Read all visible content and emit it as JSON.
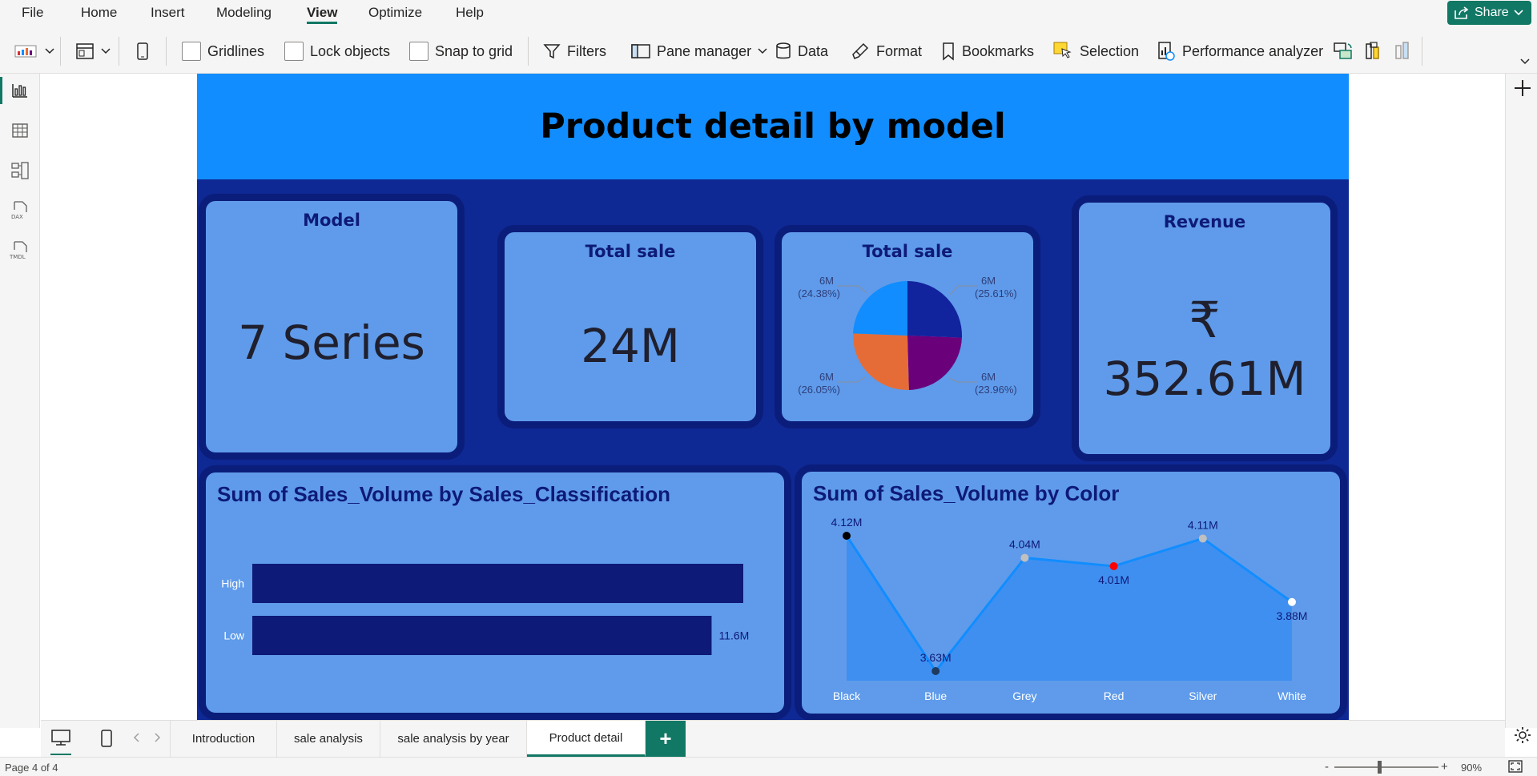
{
  "menu": {
    "items": [
      "File",
      "Home",
      "Insert",
      "Modeling",
      "View",
      "Optimize",
      "Help"
    ],
    "active": "View",
    "share_label": "Share"
  },
  "ribbon": {
    "gridlines": "Gridlines",
    "lock_objects": "Lock objects",
    "snap_to_grid": "Snap to grid",
    "filters": "Filters",
    "pane_manager": "Pane manager",
    "data": "Data",
    "format": "Format",
    "bookmarks": "Bookmarks",
    "selection": "Selection",
    "performance_analyzer": "Performance analyzer"
  },
  "rail": {
    "items": [
      "report-view-icon",
      "table-view-icon",
      "model-view-icon",
      "dax-query-icon",
      "tmdl-view-icon"
    ],
    "dax_label": "DAX",
    "tmdl_label": "TMDL"
  },
  "report": {
    "title": "Product detail by model",
    "model_card": {
      "title": "Model",
      "value": "7 Series"
    },
    "total_sale_card": {
      "title": "Total sale",
      "value": "24M"
    },
    "pie_card": {
      "title": "Total sale"
    },
    "revenue_card": {
      "title": "Revenue",
      "currency": "₹",
      "value": "352.61M"
    },
    "colors": {
      "title_band": "#118dff",
      "background": "#0e2894",
      "card": "#5f9bea",
      "bar": "#0e1a77",
      "line": "#118dff",
      "area": "#3f8ff1"
    }
  },
  "chart_data": [
    {
      "type": "pie",
      "title": "Total sale",
      "slices": [
        {
          "value_label": "6M",
          "percent_label": "(25.61%)",
          "percent": 25.61,
          "color": "#12239e"
        },
        {
          "value_label": "6M",
          "percent_label": "(23.96%)",
          "percent": 23.96,
          "color": "#6b007b"
        },
        {
          "value_label": "6M",
          "percent_label": "(26.05%)",
          "percent": 26.05,
          "color": "#e66c37"
        },
        {
          "value_label": "6M",
          "percent_label": "(24.38%)",
          "percent": 24.38,
          "color": "#118dff"
        }
      ]
    },
    {
      "type": "bar",
      "orientation": "horizontal",
      "title": "Sum of Sales_Volume by Sales_Classification",
      "categories": [
        "High",
        "Low"
      ],
      "values": [
        12.4,
        11.6
      ],
      "data_labels": [
        "",
        "11.6M"
      ],
      "xlim": [
        0,
        12.4
      ]
    },
    {
      "type": "area",
      "title": "Sum of Sales_Volume by Color",
      "categories": [
        "Black",
        "Blue",
        "Grey",
        "Red",
        "Silver",
        "White"
      ],
      "values": [
        4.12,
        3.63,
        4.04,
        4.01,
        4.11,
        3.88
      ],
      "data_labels": [
        "4.12M",
        "3.63M",
        "4.04M",
        "4.01M",
        "4.11M",
        "3.88M"
      ],
      "marker_colors": [
        "#000000",
        "#1f3a5f",
        "#c0c0c0",
        "#ff0000",
        "#c0c0c0",
        "#ffffff"
      ],
      "ylim": [
        3.63,
        4.12
      ]
    }
  ],
  "tabs": {
    "pages": [
      "Introduction",
      "sale analysis",
      "sale analysis by year",
      "Product detail"
    ],
    "active": "Product detail",
    "add_label": "+"
  },
  "status": {
    "page": "Page 4 of 4",
    "zoom": "90%",
    "minus": "-",
    "plus": "+"
  }
}
